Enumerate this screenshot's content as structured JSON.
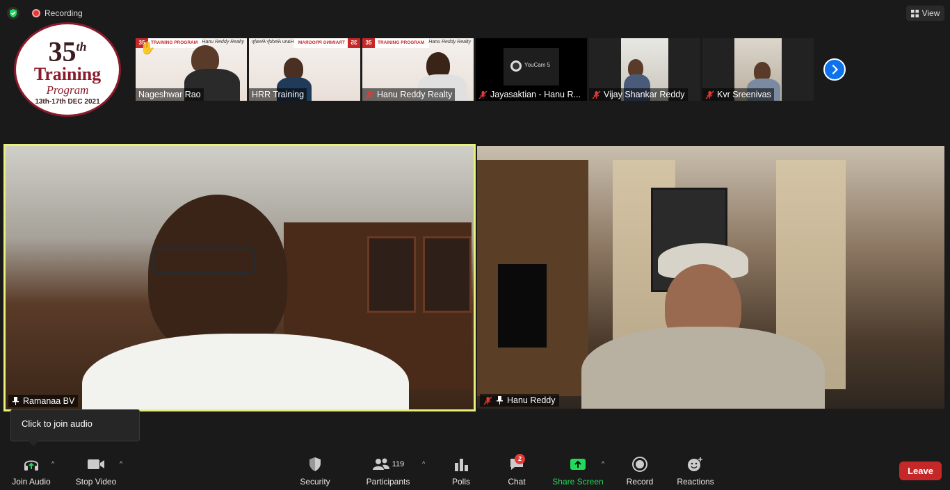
{
  "recording": {
    "label": "Recording"
  },
  "view_button": {
    "label": "View"
  },
  "logo": {
    "number": "35",
    "suffix": "th",
    "line1": "Training",
    "line2": "Program",
    "dates": "13th-17th DEC 2021"
  },
  "slide": {
    "banner": "35",
    "banner_text": "TRAINING PROGRAM",
    "logo_text": "Hanu Reddy Realty"
  },
  "thumbnails": [
    {
      "name": "Nageshwar Rao",
      "muted": false
    },
    {
      "name": "HRR Training",
      "muted": false
    },
    {
      "name": "Hanu Reddy Realty",
      "muted": true
    },
    {
      "name": "Jayasaktian - Hanu R...",
      "muted": true,
      "content": "YouCam 5"
    },
    {
      "name": "Vijay Shankar Reddy",
      "muted": true
    },
    {
      "name": "Kvr Sreenivas",
      "muted": true
    }
  ],
  "main_videos": [
    {
      "name": "Ramanaa BV",
      "pinned": true,
      "muted": false,
      "active_speaker": true
    },
    {
      "name": "Hanu Reddy",
      "pinned": true,
      "muted": true,
      "active_speaker": false
    }
  ],
  "tooltip": {
    "text": "Click to join audio"
  },
  "toolbar": {
    "join_audio": "Join Audio",
    "stop_video": "Stop Video",
    "security": "Security",
    "participants": "Participants",
    "participants_count": "119",
    "polls": "Polls",
    "chat": "Chat",
    "chat_badge": "2",
    "share_screen": "Share Screen",
    "record": "Record",
    "reactions": "Reactions",
    "leave": "Leave"
  },
  "colors": {
    "accent": "#0e72ed",
    "share_green": "#23d959",
    "leave_red": "#c62828",
    "active_border": "#e8ef7a"
  }
}
